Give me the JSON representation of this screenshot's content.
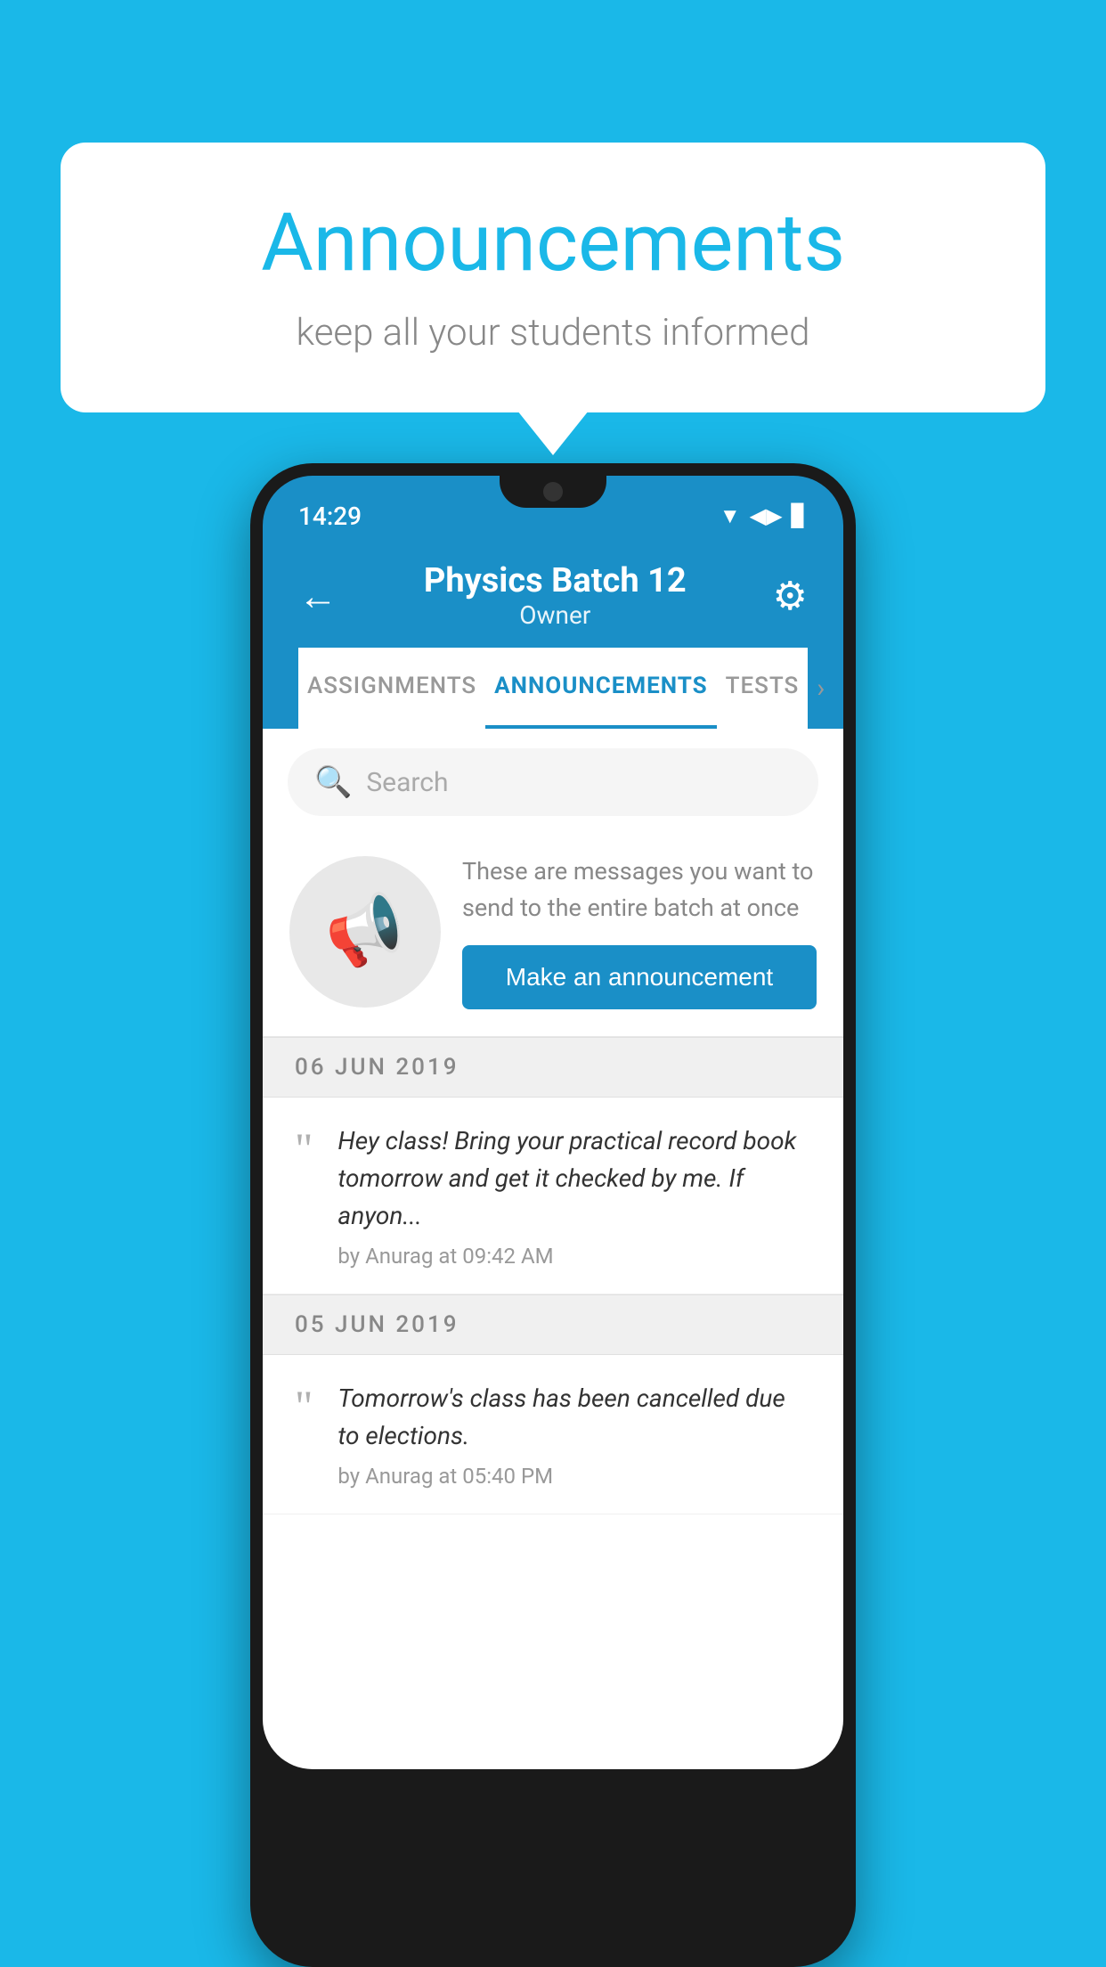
{
  "bubble": {
    "title": "Announcements",
    "subtitle": "keep all your students informed"
  },
  "status_bar": {
    "time": "14:29",
    "wifi": "▲",
    "signal": "▲",
    "battery": "▊"
  },
  "header": {
    "title": "Physics Batch 12",
    "subtitle": "Owner",
    "back_label": "←",
    "gear_label": "⚙"
  },
  "tabs": [
    {
      "label": "ASSIGNMENTS",
      "active": false
    },
    {
      "label": "ANNOUNCEMENTS",
      "active": true
    },
    {
      "label": "TESTS",
      "active": false
    }
  ],
  "search": {
    "placeholder": "Search"
  },
  "promo": {
    "text": "These are messages you want to send to the entire batch at once",
    "button_label": "Make an announcement"
  },
  "messages": [
    {
      "date": "06  JUN  2019",
      "text": "Hey class! Bring your practical record book tomorrow and get it checked by me. If anyon...",
      "meta": "by Anurag at 09:42 AM"
    },
    {
      "date": "05  JUN  2019",
      "text": "Tomorrow's class has been cancelled due to elections.",
      "meta": "by Anurag at 05:40 PM"
    }
  ]
}
